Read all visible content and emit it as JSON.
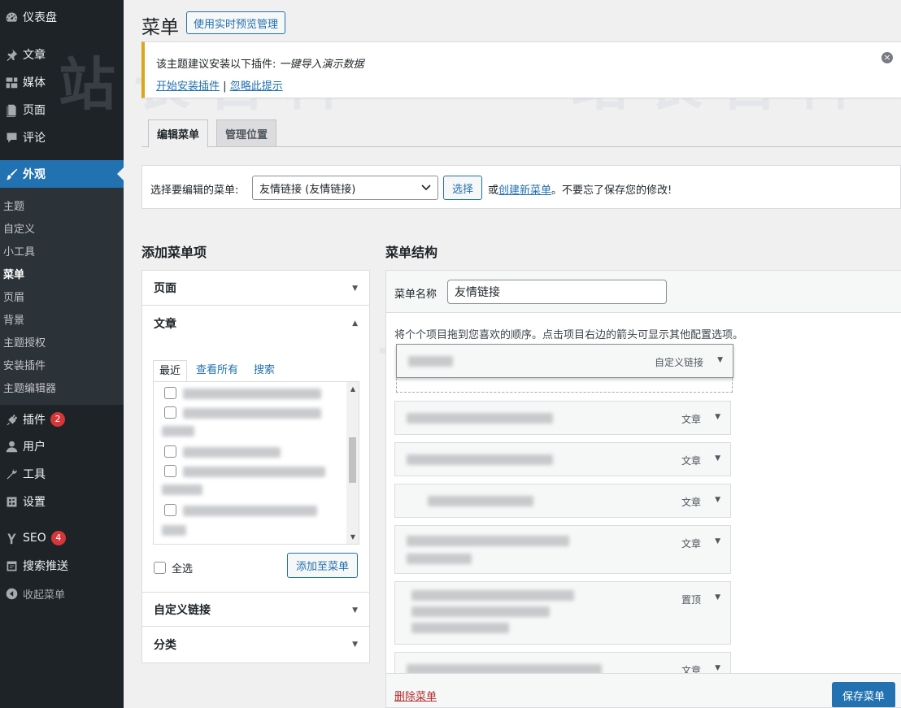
{
  "sidebar": {
    "items": [
      {
        "label": "仪表盘",
        "icon": "dashboard-icon"
      },
      {
        "label": "文章",
        "icon": "pin-icon"
      },
      {
        "label": "媒体",
        "icon": "media-icon"
      },
      {
        "label": "页面",
        "icon": "page-icon"
      },
      {
        "label": "评论",
        "icon": "comment-icon"
      },
      {
        "label": "外观",
        "icon": "brush-icon"
      },
      {
        "label": "插件",
        "icon": "plugin-icon",
        "badge": "2"
      },
      {
        "label": "用户",
        "icon": "user-icon"
      },
      {
        "label": "工具",
        "icon": "wrench-icon"
      },
      {
        "label": "设置",
        "icon": "settings-icon"
      },
      {
        "label": "SEO",
        "icon": "seo-icon",
        "badge": "4"
      },
      {
        "label": "搜索推送",
        "icon": "push-icon"
      },
      {
        "label": "收起菜单",
        "icon": "collapse-icon"
      }
    ],
    "submenu": [
      "主题",
      "自定义",
      "小工具",
      "菜单",
      "页眉",
      "背景",
      "主题授权",
      "安装插件",
      "主题编辑器"
    ]
  },
  "header": {
    "title": "菜单",
    "live_preview_button": "使用实时预览管理"
  },
  "notice": {
    "text": "该主题建议安装以下插件:",
    "plugin_name": "一键导入演示数据",
    "install_link": "开始安装插件",
    "separator": "|",
    "dismiss_link": "忽略此提示"
  },
  "tabs": [
    "编辑菜单",
    "管理位置"
  ],
  "select_menu": {
    "label": "选择要编辑的菜单:",
    "value": "友情链接 (友情链接)",
    "button": "选择",
    "or": "或",
    "create_link": "创建新菜单",
    "tail": "。不要忘了保存您的修改!"
  },
  "add_items": {
    "title": "添加菜单项",
    "sections": [
      "页面",
      "文章",
      "自定义链接",
      "分类"
    ],
    "inner_tabs": [
      "最近",
      "查看所有",
      "搜索"
    ],
    "select_all": "全选",
    "add_button": "添加至菜单"
  },
  "structure": {
    "title": "菜单结构",
    "name_label": "菜单名称",
    "name_value": "友情链接",
    "instructions": "将个个项目拖到您喜欢的顺序。点击项目右边的箭头可显示其他配置选项。",
    "items": [
      {
        "type": "自定义链接"
      },
      {
        "type": "文章"
      },
      {
        "type": "文章"
      },
      {
        "type": "文章"
      },
      {
        "type": "文章"
      },
      {
        "type": "置顶"
      },
      {
        "type": "文章"
      }
    ],
    "delete_link": "删除菜单",
    "save_button": "保存菜单"
  }
}
